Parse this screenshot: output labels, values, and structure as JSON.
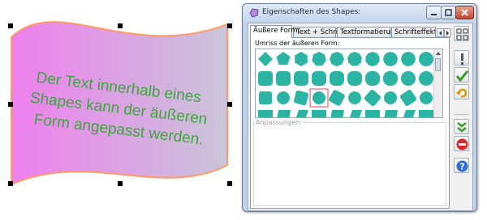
{
  "canvas": {
    "text_lines": [
      "Der Text innerhalb eines",
      "Shapes kann der äußeren",
      "Form angepasst werden."
    ],
    "shape_gradient": [
      "#ee82ee",
      "#c8c8d8"
    ],
    "shape_outline_color": "#ff9966",
    "text_color": "#3aa83a"
  },
  "window": {
    "title": "Eigenschaften des Shapes:",
    "icon": "shape-properties-icon",
    "title_buttons": [
      "minimize-icon",
      "maximize-icon",
      "close-icon"
    ]
  },
  "tabs": [
    {
      "label": "Äußere Form",
      "active": true
    },
    {
      "label": "Text + Schrift",
      "active": false
    },
    {
      "label": "Textformatierung",
      "active": false
    },
    {
      "label": "Schrifteffekte",
      "active": false
    }
  ],
  "panel": {
    "outline_label": "Umriss der äußeren Form:",
    "adjustments_label": "Anpassungen:",
    "gallery_color": "#2bb3a3",
    "selected_shape_index": 23,
    "gallery_shape_count": 40
  },
  "side_buttons": [
    {
      "name": "grid-layout-button",
      "icon": "grid-icon"
    },
    {
      "name": "attention-button",
      "icon": "exclamation-icon"
    },
    {
      "name": "apply-button",
      "icon": "checkmark-icon"
    },
    {
      "name": "undo-button",
      "icon": "undo-arrow-icon"
    },
    {
      "name": "expand-button",
      "icon": "double-chevron-down-icon"
    },
    {
      "name": "cancel-button",
      "icon": "no-entry-icon"
    },
    {
      "name": "help-button",
      "icon": "help-icon"
    }
  ],
  "accent_colors": {
    "window_frame": "#bfd2e8",
    "selection": "#e0454e"
  }
}
